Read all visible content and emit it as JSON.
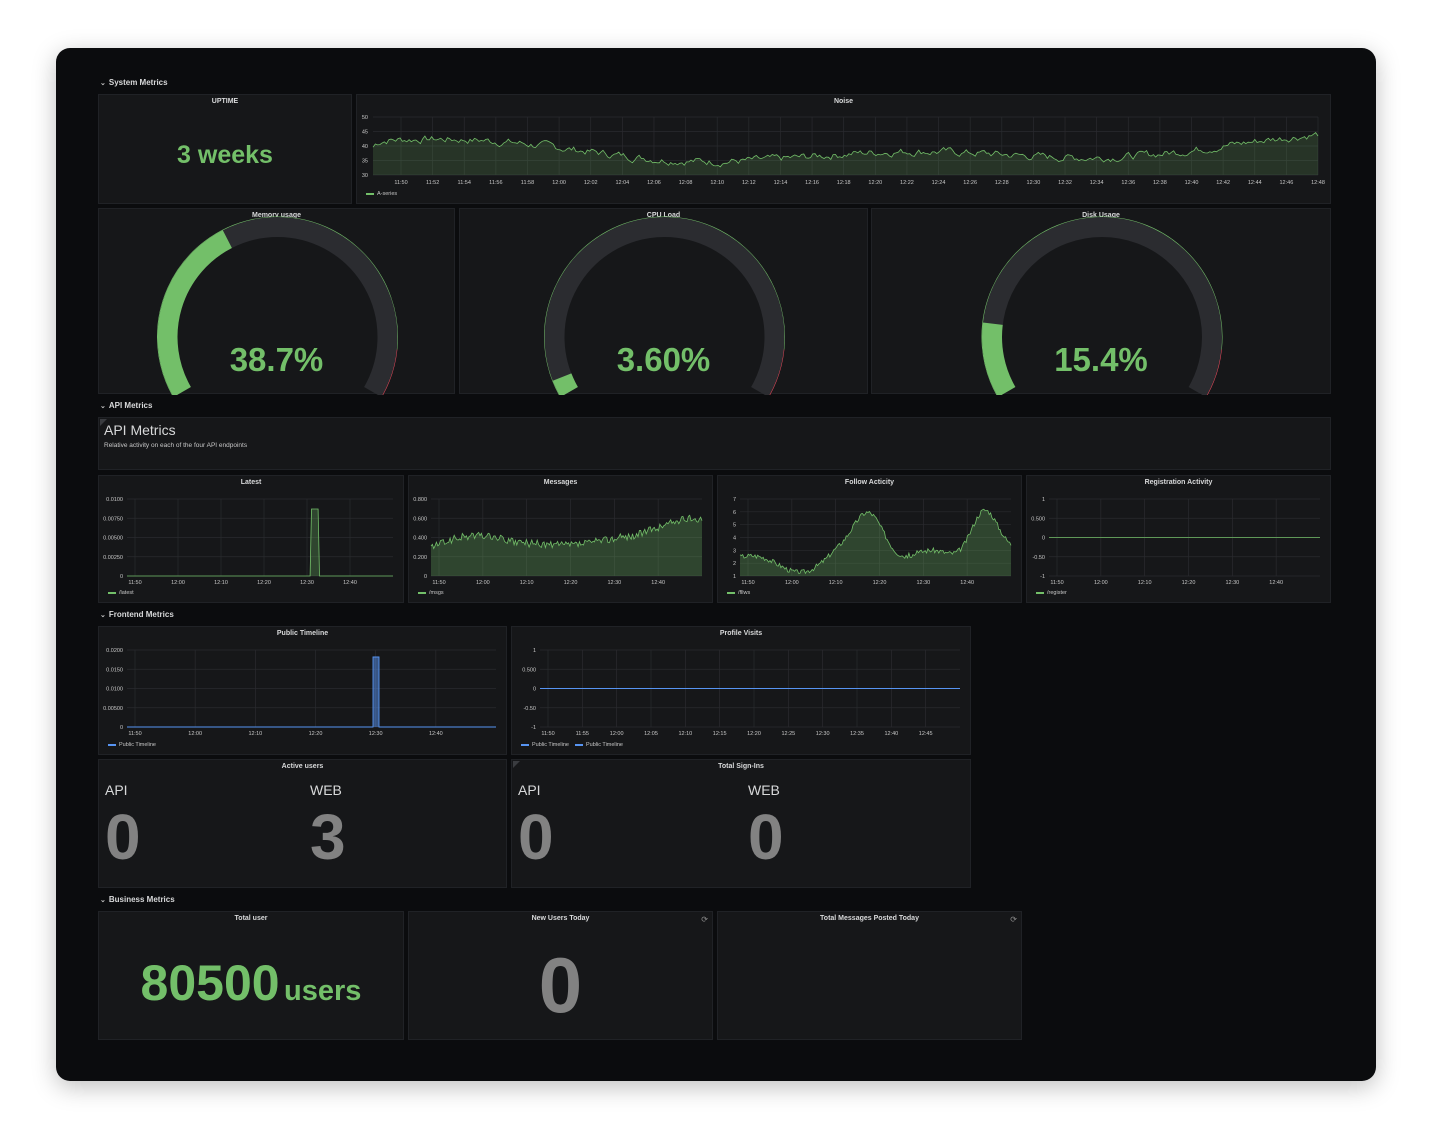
{
  "colors": {
    "green": "#73bf69",
    "red": "#f2495c",
    "blue": "#5794f2",
    "grey": "#828282",
    "panel": "#161719",
    "track": "#2b2c30"
  },
  "rows": {
    "system": "System Metrics",
    "api": "API Metrics",
    "frontend": "Frontend Metrics",
    "business": "Business Metrics"
  },
  "uptime": {
    "title": "UPTIME",
    "value": "3 weeks"
  },
  "noise": {
    "title": "Noise",
    "yticks": [
      "50",
      "45",
      "40",
      "35",
      "30"
    ],
    "xticks": [
      "11:50",
      "11:52",
      "11:54",
      "11:56",
      "11:58",
      "12:00",
      "12:02",
      "12:04",
      "12:06",
      "12:08",
      "12:10",
      "12:12",
      "12:14",
      "12:16",
      "12:18",
      "12:20",
      "12:22",
      "12:24",
      "12:26",
      "12:28",
      "12:30",
      "12:32",
      "12:34",
      "12:36",
      "12:38",
      "12:40",
      "12:42",
      "12:44",
      "12:46",
      "12:48"
    ],
    "legend": "A-series"
  },
  "gauges": [
    {
      "title": "Memory usage",
      "value_text": "38.7%",
      "value": 38.7
    },
    {
      "title": "CPU Load",
      "value_text": "3.60%",
      "value": 3.6
    },
    {
      "title": "Disk Usage",
      "value_text": "15.4%",
      "value": 15.4
    }
  ],
  "api_text": {
    "heading": "API Metrics",
    "description": "Relative activity on each of the four API endpoints"
  },
  "api_charts": [
    {
      "title": "Latest",
      "yticks": [
        "0.0100",
        "0.00750",
        "0.00500",
        "0.00250",
        "0"
      ],
      "xticks": [
        "11:50",
        "12:00",
        "12:10",
        "12:20",
        "12:30",
        "12:40"
      ],
      "legend": "/latest"
    },
    {
      "title": "Messages",
      "yticks": [
        "0.800",
        "0.600",
        "0.400",
        "0.200",
        "0"
      ],
      "xticks": [
        "11:50",
        "12:00",
        "12:10",
        "12:20",
        "12:30",
        "12:40"
      ],
      "legend": "/msgs"
    },
    {
      "title": "Follow Acticity",
      "yticks": [
        "7",
        "6",
        "5",
        "4",
        "3",
        "2",
        "1"
      ],
      "xticks": [
        "11:50",
        "12:00",
        "12:10",
        "12:20",
        "12:30",
        "12:40"
      ],
      "legend": "/fllws"
    },
    {
      "title": "Registration Activity",
      "yticks": [
        "1",
        "0.500",
        "0",
        "-0.50",
        "-1"
      ],
      "xticks": [
        "11:50",
        "12:00",
        "12:10",
        "12:20",
        "12:30",
        "12:40"
      ],
      "legend": "/register"
    }
  ],
  "frontend_charts": [
    {
      "title": "Public Timeline",
      "yticks": [
        "0.0200",
        "0.0150",
        "0.0100",
        "0.00500",
        "0"
      ],
      "xticks": [
        "11:50",
        "12:00",
        "12:10",
        "12:20",
        "12:30",
        "12:40"
      ],
      "legends": [
        "Public Timeline"
      ]
    },
    {
      "title": "Profile Visits",
      "yticks": [
        "1",
        "0.500",
        "0",
        "-0.50",
        "-1"
      ],
      "xticks": [
        "11:50",
        "11:55",
        "12:00",
        "12:05",
        "12:10",
        "12:15",
        "12:20",
        "12:25",
        "12:30",
        "12:35",
        "12:40",
        "12:45"
      ],
      "legends": [
        "Public Timeline",
        "Public Timeline"
      ]
    }
  ],
  "active_users": {
    "title": "Active users",
    "api_label": "API",
    "api_value": "0",
    "web_label": "WEB",
    "web_value": "3"
  },
  "sign_ins": {
    "title": "Total Sign-Ins",
    "api_label": "API",
    "api_value": "0",
    "web_label": "WEB",
    "web_value": "0"
  },
  "business": {
    "total_user": {
      "title": "Total user",
      "value": "80500",
      "unit": "users"
    },
    "new_users": {
      "title": "New Users Today",
      "value": "0"
    },
    "messages_today": {
      "title": "Total Messages Posted Today"
    }
  }
}
